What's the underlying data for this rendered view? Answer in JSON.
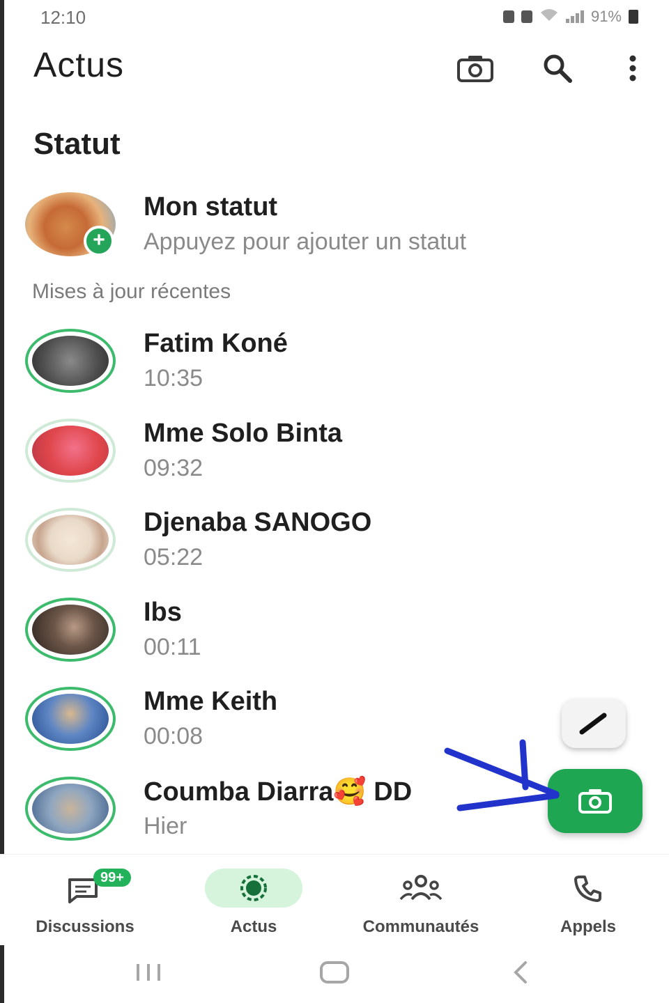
{
  "status_bar": {
    "time": "12:10",
    "battery": "91%"
  },
  "app_bar": {
    "title": "Actus",
    "icons": [
      "camera-icon",
      "search-icon",
      "more-vert-icon"
    ]
  },
  "status_section": {
    "title": "Statut",
    "my_status": {
      "name": "Mon statut",
      "hint": "Appuyez pour ajouter un statut"
    },
    "recent_label": "Mises à jour récentes",
    "updates": [
      {
        "name": "Fatim Koné",
        "time": "10:35",
        "avatar_color": "#5b5b5b"
      },
      {
        "name": "Mme Solo Binta",
        "time": "09:32",
        "avatar_color": "#e0474c"
      },
      {
        "name": "Djenaba SANOGO",
        "time": "05:22",
        "avatar_color": "#e9d9c8"
      },
      {
        "name": "Ibs",
        "time": "00:11",
        "avatar_color": "#3a2e28"
      },
      {
        "name": "Mme Keith",
        "time": "00:08",
        "avatar_color": "#3d6fb5"
      },
      {
        "name": "Coumba Diarra🥰 DD",
        "time": "Hier",
        "avatar_color": "#8fa6c0"
      }
    ]
  },
  "fabs": {
    "edit_icon": "pencil-icon",
    "camera_icon": "camera-icon"
  },
  "bottom_nav": [
    {
      "label": "Discussions",
      "icon": "chat-icon",
      "badge": "99+",
      "active": false
    },
    {
      "label": "Actus",
      "icon": "updates-icon",
      "active": true
    },
    {
      "label": "Communautés",
      "icon": "communities-icon",
      "active": false
    },
    {
      "label": "Appels",
      "icon": "phone-icon",
      "active": false
    }
  ],
  "colors": {
    "accent": "#1ea652",
    "active_tab_bg": "#d6f3db",
    "annotation": "#2233cc"
  }
}
